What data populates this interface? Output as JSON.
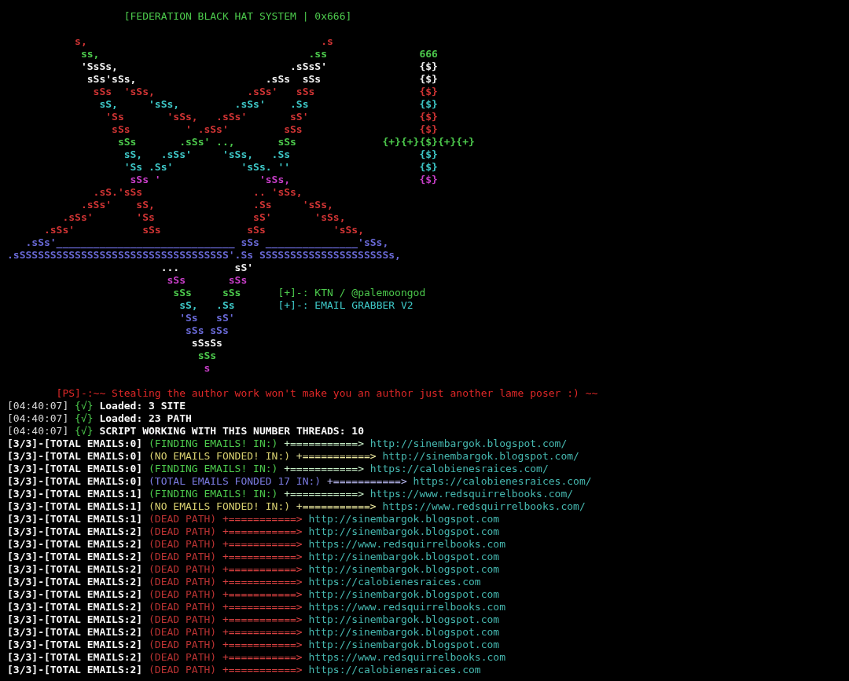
{
  "title": "[FEDERATION BLACK HAT SYSTEM | 0x666]",
  "art": [
    {
      "segments": [
        {
          "kind": "art",
          "color": "#d03434",
          "text": "           s,                                      .s"
        }
      ]
    },
    {
      "segments": [
        {
          "kind": "art",
          "color": "#4cc94c",
          "text": "            ss,                                  .ss"
        },
        {
          "kind": "art",
          "color": "#4cc94c",
          "text": "               666"
        }
      ]
    },
    {
      "segments": [
        {
          "kind": "art",
          "color": "#f2f2f2",
          "text": "            'SsSs,                            .sSsS'"
        },
        {
          "kind": "art",
          "color": "#f2f2f2",
          "text": "               {$}"
        }
      ]
    },
    {
      "segments": [
        {
          "kind": "art",
          "color": "#f2f2f2",
          "text": "             sSs'sSs,                     .sSs  sSs"
        },
        {
          "kind": "art",
          "color": "#f2f2f2",
          "text": "                {$}"
        }
      ]
    },
    {
      "segments": [
        {
          "kind": "art",
          "color": "#d03434",
          "text": "              sSs  'sSs,               .sSs'   sSs"
        },
        {
          "kind": "art",
          "color": "#d03434",
          "text": "                 {$}"
        }
      ]
    },
    {
      "segments": [
        {
          "kind": "art",
          "color": "#3ec8c8",
          "text": "               sS,     'sSs,         .sSs'    .Ss"
        },
        {
          "kind": "art",
          "color": "#3ec8c8",
          "text": "                  {$}"
        }
      ]
    },
    {
      "segments": [
        {
          "kind": "art",
          "color": "#d03434",
          "text": "                'Ss       'sSs,   .sSs'       sS'"
        },
        {
          "kind": "art",
          "color": "#d03434",
          "text": "                  {$}"
        }
      ]
    },
    {
      "segments": [
        {
          "kind": "art",
          "color": "#d03434",
          "text": "                 sSs         ' .sSs'         sSs"
        },
        {
          "kind": "art",
          "color": "#d03434",
          "text": "                   {$}"
        }
      ]
    },
    {
      "segments": [
        {
          "kind": "art",
          "color": "#4cc94c",
          "text": "                  sSs       .sSs' ..,       sSs"
        },
        {
          "kind": "art",
          "color": "#4cc94c",
          "text": "              {+}{+}{$}{+}{+}"
        }
      ]
    },
    {
      "segments": [
        {
          "kind": "art",
          "color": "#3ec8c8",
          "text": "                   sS,   .sSs'     'sSs,   .Ss"
        },
        {
          "kind": "art",
          "color": "#3ec8c8",
          "text": "                     {$}"
        }
      ]
    },
    {
      "segments": [
        {
          "kind": "art",
          "color": "#3ec8c8",
          "text": "                   'Ss .Ss'           'sSs. ''"
        },
        {
          "kind": "art",
          "color": "#3ec8c8",
          "text": "                     {$}"
        }
      ]
    },
    {
      "segments": [
        {
          "kind": "art",
          "color": "#c83ec8",
          "text": "                    sSs '                'sSs,"
        },
        {
          "kind": "art",
          "color": "#c83ec8",
          "text": "                     {$}"
        }
      ]
    },
    {
      "segments": [
        {
          "kind": "art",
          "color": "#d03434",
          "text": "              .sS.'sSs                  .. 'sSs,"
        }
      ]
    },
    {
      "segments": [
        {
          "kind": "art",
          "color": "#d03434",
          "text": "            .sSs'    sS,                .Ss     'sSs,"
        }
      ]
    },
    {
      "segments": [
        {
          "kind": "art",
          "color": "#d03434",
          "text": "         .sSs'       'Ss                sS'       'sSs,"
        }
      ]
    },
    {
      "segments": [
        {
          "kind": "art",
          "color": "#d03434",
          "text": "      .sSs'           sSs              sSs           'sSs,"
        }
      ]
    },
    {
      "segments": [
        {
          "kind": "art",
          "color": "#6a6ad8",
          "text": "   .sSs'_____________________________ sSs _______________'sSs,"
        }
      ]
    },
    {
      "segments": [
        {
          "kind": "art",
          "color": "#6a6ad8",
          "text": ".sSSSSSSSSSSSSSSSSSSSSSSSSSSSSSSSSSS'.Ss SSSSSSSSSSSSSSSSSSSSSs,"
        }
      ]
    },
    {
      "segments": [
        {
          "kind": "art",
          "color": "#f2f2f2",
          "text": "                         ...         sS'"
        }
      ]
    },
    {
      "segments": [
        {
          "kind": "art",
          "color": "#c83ec8",
          "text": "                          sSs       sSs"
        }
      ]
    },
    {
      "segments": [
        {
          "kind": "art",
          "color": "#4cc94c",
          "text": "                           sSs     sSs"
        },
        {
          "kind": "text",
          "color": "#4cc94c",
          "text": "      [+]-: KTN / @palemoongod"
        }
      ]
    },
    {
      "segments": [
        {
          "kind": "art",
          "color": "#3ec8c8",
          "text": "                            sS,   .Ss"
        },
        {
          "kind": "text",
          "color": "#3ec8c8",
          "text": "       [+]-: EMAIL GRABBER V2"
        }
      ]
    },
    {
      "segments": [
        {
          "kind": "art",
          "color": "#6a6ad8",
          "text": "                            'Ss   sS'"
        }
      ]
    },
    {
      "segments": [
        {
          "kind": "art",
          "color": "#6a6ad8",
          "text": "                             sSs sSs"
        }
      ]
    },
    {
      "segments": [
        {
          "kind": "art",
          "color": "#f2f2f2",
          "text": "                              sSsSs"
        }
      ]
    },
    {
      "segments": [
        {
          "kind": "art",
          "color": "#4cc94c",
          "text": "                               sSs"
        }
      ]
    },
    {
      "segments": [
        {
          "kind": "art",
          "color": "#c83ec8",
          "text": "                                s"
        }
      ]
    }
  ],
  "warning": "[PS]-:~~ Stealing the author work won't make you an author just another lame poser :) ~~",
  "loaded": [
    {
      "time": "[04:40:07]",
      "mark": "{√}",
      "text": "Loaded: 3 SITE"
    },
    {
      "time": "[04:40:07]",
      "mark": "{√}",
      "text": "Loaded: 23 PATH"
    },
    {
      "time": "[04:40:07]",
      "mark": "{√}",
      "text": "SCRIPT WORKING WITH THIS NUMBER THREADS: 10"
    }
  ],
  "rows": [
    {
      "counter": "[3/3]-[TOTAL EMAILS:0]",
      "kind": "finding",
      "status": "(FINDING EMAILS! IN:)",
      "arrow": "+===========>",
      "url": "http://sinembargok.blogspot.com/"
    },
    {
      "counter": "[3/3]-[TOTAL EMAILS:0]",
      "kind": "none",
      "status": "(NO EMAILS FONDED! IN:)",
      "arrow": "+===========>",
      "url": "http://sinembargok.blogspot.com/"
    },
    {
      "counter": "[3/3]-[TOTAL EMAILS:0]",
      "kind": "finding",
      "status": "(FINDING EMAILS! IN:)",
      "arrow": "+===========>",
      "url": "https://calobienesraices.com/"
    },
    {
      "counter": "[3/3]-[TOTAL EMAILS:0]",
      "kind": "found",
      "status": "(TOTAL EMAILS FONDED 17 IN:)",
      "arrow": "+===========>",
      "url": "https://calobienesraices.com/"
    },
    {
      "counter": "[3/3]-[TOTAL EMAILS:1]",
      "kind": "finding",
      "status": "(FINDING EMAILS! IN:)",
      "arrow": "+===========>",
      "url": "https://www.redsquirrelbooks.com/"
    },
    {
      "counter": "[3/3]-[TOTAL EMAILS:1]",
      "kind": "none",
      "status": "(NO EMAILS FONDED! IN:)",
      "arrow": "+===========>",
      "url": "https://www.redsquirrelbooks.com/"
    },
    {
      "counter": "[3/3]-[TOTAL EMAILS:1]",
      "kind": "dead",
      "status": "(DEAD PATH)",
      "arrow": "+===========>",
      "url": "http://sinembargok.blogspot.com"
    },
    {
      "counter": "[3/3]-[TOTAL EMAILS:2]",
      "kind": "dead",
      "status": "(DEAD PATH)",
      "arrow": "+===========>",
      "url": "http://sinembargok.blogspot.com"
    },
    {
      "counter": "[3/3]-[TOTAL EMAILS:2]",
      "kind": "dead",
      "status": "(DEAD PATH)",
      "arrow": "+===========>",
      "url": "https://www.redsquirrelbooks.com"
    },
    {
      "counter": "[3/3]-[TOTAL EMAILS:2]",
      "kind": "dead",
      "status": "(DEAD PATH)",
      "arrow": "+===========>",
      "url": "http://sinembargok.blogspot.com"
    },
    {
      "counter": "[3/3]-[TOTAL EMAILS:2]",
      "kind": "dead",
      "status": "(DEAD PATH)",
      "arrow": "+===========>",
      "url": "http://sinembargok.blogspot.com"
    },
    {
      "counter": "[3/3]-[TOTAL EMAILS:2]",
      "kind": "dead",
      "status": "(DEAD PATH)",
      "arrow": "+===========>",
      "url": "https://calobienesraices.com"
    },
    {
      "counter": "[3/3]-[TOTAL EMAILS:2]",
      "kind": "dead",
      "status": "(DEAD PATH)",
      "arrow": "+===========>",
      "url": "http://sinembargok.blogspot.com"
    },
    {
      "counter": "[3/3]-[TOTAL EMAILS:2]",
      "kind": "dead",
      "status": "(DEAD PATH)",
      "arrow": "+===========>",
      "url": "https://www.redsquirrelbooks.com"
    },
    {
      "counter": "[3/3]-[TOTAL EMAILS:2]",
      "kind": "dead",
      "status": "(DEAD PATH)",
      "arrow": "+===========>",
      "url": "http://sinembargok.blogspot.com"
    },
    {
      "counter": "[3/3]-[TOTAL EMAILS:2]",
      "kind": "dead",
      "status": "(DEAD PATH)",
      "arrow": "+===========>",
      "url": "http://sinembargok.blogspot.com"
    },
    {
      "counter": "[3/3]-[TOTAL EMAILS:2]",
      "kind": "dead",
      "status": "(DEAD PATH)",
      "arrow": "+===========>",
      "url": "http://sinembargok.blogspot.com"
    },
    {
      "counter": "[3/3]-[TOTAL EMAILS:2]",
      "kind": "dead",
      "status": "(DEAD PATH)",
      "arrow": "+===========>",
      "url": "https://www.redsquirrelbooks.com"
    },
    {
      "counter": "[3/3]-[TOTAL EMAILS:2]",
      "kind": "dead",
      "status": "(DEAD PATH)",
      "arrow": "+===========>",
      "url": "https://calobienesraices.com"
    }
  ]
}
